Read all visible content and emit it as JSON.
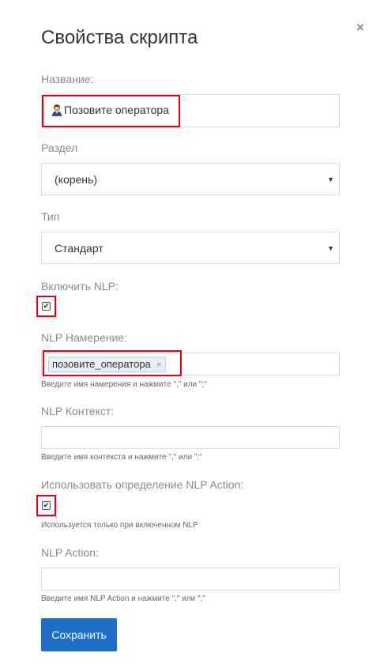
{
  "dialog": {
    "title": "Свойства скрипта",
    "close_glyph": "×"
  },
  "fields": {
    "name": {
      "label": "Название:",
      "value": "Позовите оператора",
      "icon": "person-icon"
    },
    "section": {
      "label": "Раздел",
      "value": "(корень)",
      "arrow": "▼"
    },
    "type": {
      "label": "Тип",
      "value": "Стандарт",
      "arrow": "▼"
    },
    "enable_nlp": {
      "label": "Включить NLP:",
      "checked": true,
      "check_glyph": "✔"
    },
    "nlp_intent": {
      "label": "NLP Намерение:",
      "tags": [
        "позовите_оператора"
      ],
      "tag_remove_glyph": "×",
      "hint": "Введите имя намерения и нажмите \",\" или \";\""
    },
    "nlp_context": {
      "label": "NLP Контекст:",
      "value": "",
      "hint": "Введите имя контекста и нажмите \",\" или \";\""
    },
    "use_nlp_action": {
      "label": "Использовать определение NLP Action:",
      "checked": true,
      "check_glyph": "✔",
      "hint": "Используется только при включенном NLP"
    },
    "nlp_action": {
      "label": "NLP Action:",
      "value": "",
      "hint": "Введите имя NLP Action и нажмите \",\" или \";\""
    }
  },
  "buttons": {
    "save": "Сохранить"
  },
  "colors": {
    "primary": "#1f6fc9",
    "highlight": "#e3000f",
    "label": "#8a8a8a"
  }
}
